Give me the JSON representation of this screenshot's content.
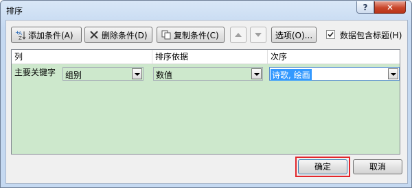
{
  "window": {
    "title": "排序",
    "help_label": "?",
    "close_label": "✕"
  },
  "toolbar": {
    "add_label": "添加条件(A)",
    "delete_label": "删除条件(D)",
    "copy_label": "复制条件(C)",
    "options_label": "选项(O)...",
    "header_checkbox_label": "数据包含标题(H)",
    "header_checkbox_checked": true
  },
  "grid": {
    "headers": [
      "列",
      "排序依据",
      "次序"
    ],
    "rows": [
      {
        "label": "主要关键字",
        "column": "组别",
        "sort_on": "数值",
        "order": "诗歌, 绘画"
      }
    ]
  },
  "footer": {
    "ok_label": "确定",
    "cancel_label": "取消"
  },
  "colors": {
    "highlight": "#e2262b",
    "grid_bg": "#cde8cc",
    "selection": "#3399ff"
  }
}
